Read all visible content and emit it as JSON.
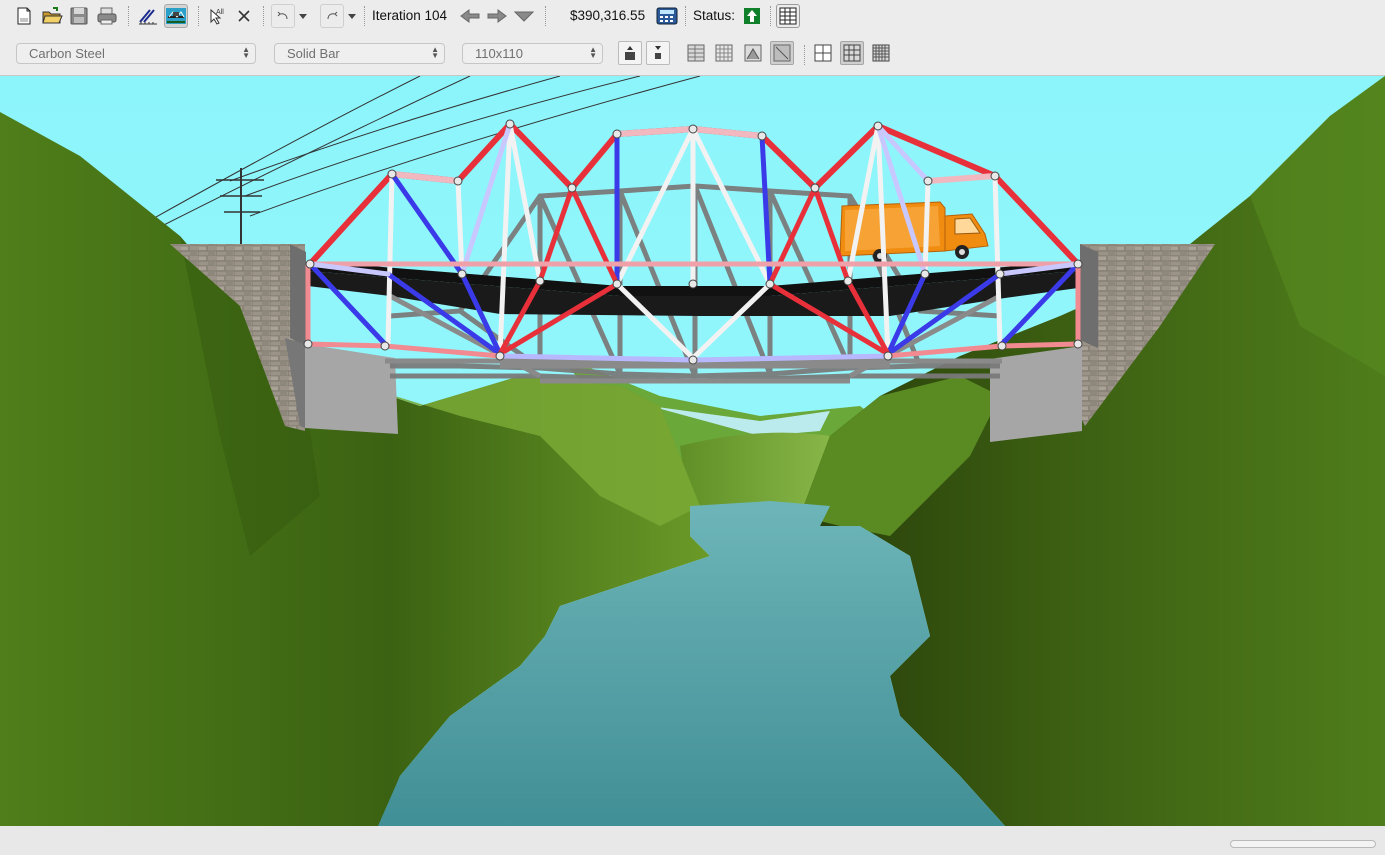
{
  "toolbar": {
    "iteration_label": "Iteration 104",
    "cost": "$390,316.55",
    "status_label": "Status:"
  },
  "member_properties": {
    "material": "Carbon Steel",
    "cross_section": "Solid Bar",
    "size": "110x110"
  },
  "colors": {
    "sky": "#8cf5fb",
    "compression": "#e8303a",
    "tension": "#3a3ae8",
    "neutral": "#f2f2f2",
    "truck": "#f08c10",
    "water": "#4f9ea4"
  },
  "icons": [
    "new-document-icon",
    "open-folder-icon",
    "save-icon",
    "print-icon",
    "draw-members-icon",
    "load-test-icon",
    "select-all-icon",
    "delete-icon",
    "undo-icon",
    "redo-icon",
    "back-iteration-icon",
    "forward-iteration-icon",
    "iteration-menu-icon",
    "cost-calculator-icon",
    "status-pass-icon",
    "report-icon"
  ]
}
